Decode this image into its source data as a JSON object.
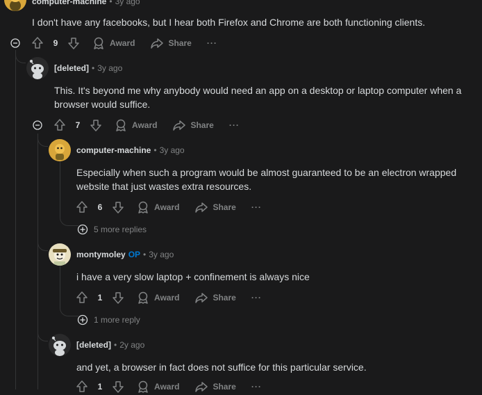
{
  "comments": [
    {
      "author": "computer-machine",
      "op": "",
      "time": "3y ago",
      "body": "I don't have any facebooks, but I hear both Firefox and Chrome are both functioning clients.",
      "votes": "9"
    },
    {
      "author": "[deleted]",
      "op": "",
      "time": "3y ago",
      "body": "This. It's beyond me why anybody would need an app on a desktop or laptop computer when a browser would suffice.",
      "votes": "7"
    },
    {
      "author": "computer-machine",
      "op": "",
      "time": "3y ago",
      "body": "Especially when such a program would be almost guaranteed to be an electron wrapped website that just wastes extra resources.",
      "votes": "6",
      "more_replies": "5 more replies"
    },
    {
      "author": "montymoley",
      "op": "OP",
      "time": "3y ago",
      "body": "i have a very slow laptop + confinement is always nice",
      "votes": "1",
      "more_replies": "1 more reply"
    },
    {
      "author": "[deleted]",
      "op": "",
      "time": "2y ago",
      "body": "and yet, a browser in fact does not suffice for this particular service.",
      "votes": "1"
    }
  ],
  "labels": {
    "award": "Award",
    "share": "Share",
    "more": "···",
    "sep": "•"
  },
  "icons": {
    "upvote": "upvote-icon",
    "downvote": "downvote-icon",
    "award": "award-icon",
    "share": "share-icon",
    "collapse": "collapse-icon",
    "expand": "expand-icon"
  },
  "colors": {
    "background": "#1a1a1b",
    "text": "#d7dadc",
    "muted": "#818384",
    "op": "#0079d3",
    "line": "#343536"
  }
}
